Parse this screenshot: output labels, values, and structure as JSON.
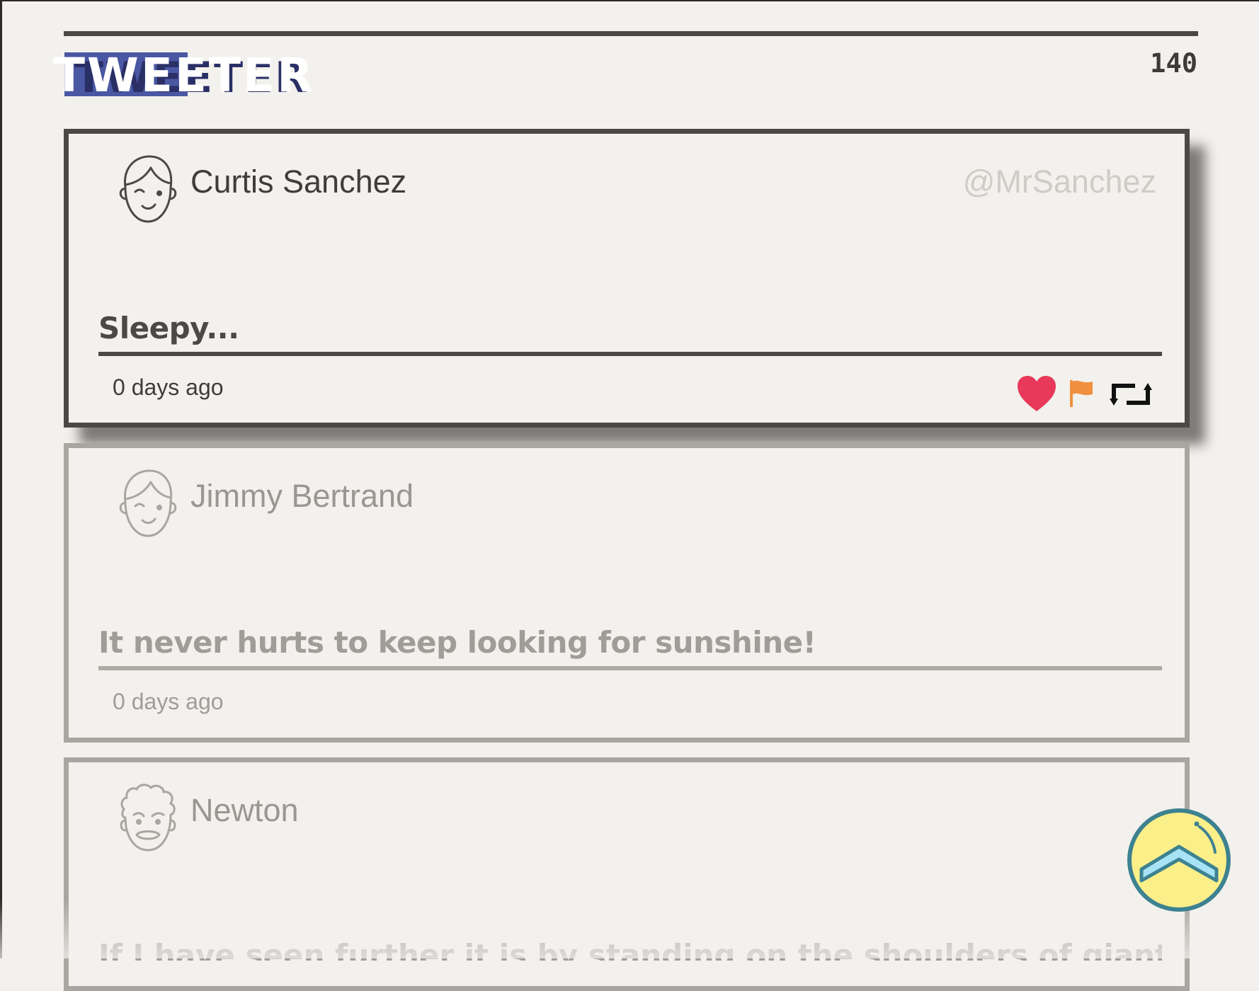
{
  "header": {
    "logo_text": "TWEETER",
    "char_counter": "140"
  },
  "tweets": [
    {
      "name": "Curtis Sanchez",
      "handle": "@MrSanchez",
      "text": "Sleepy...",
      "time": "0 days ago",
      "avatar_icon": "boy-face-icon",
      "actions": [
        "like-icon",
        "flag-icon",
        "retweet-icon"
      ],
      "active": true
    },
    {
      "name": "Jimmy Bertrand",
      "handle": "",
      "text": "It never hurts to keep looking for sunshine!",
      "time": "0 days ago",
      "avatar_icon": "boy-face-icon",
      "active": false
    },
    {
      "name": "Newton",
      "handle": "",
      "text": "If I have seen further it is by standing on the shoulders of giants.",
      "time": "",
      "avatar_icon": "curly-hair-face-icon",
      "active": false
    }
  ],
  "colors": {
    "background": "#f3f1ed",
    "border": "#4b4845",
    "faded_border": "#a9a6a1",
    "like": "#e8395a",
    "flag": "#f0903f",
    "logo_accent": "#4a57a3",
    "scroll_button_fill": "#fbef8a",
    "scroll_button_ring": "#3d8290"
  },
  "scroll_top_icon": "chevron-up-icon"
}
